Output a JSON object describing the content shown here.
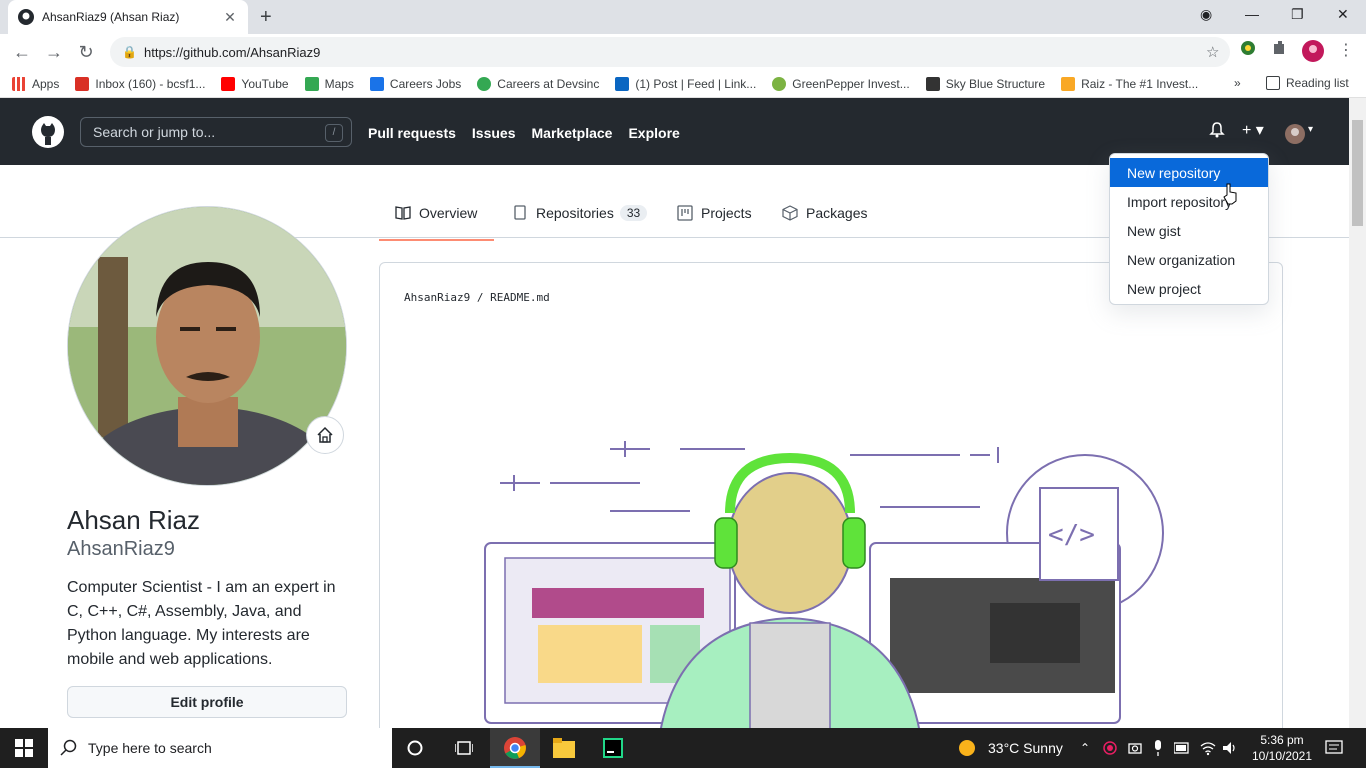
{
  "browser": {
    "tab_title": "AhsanRiaz9 (Ahsan Riaz)",
    "url": "https://github.com/AhsanRiaz9",
    "bookmarks": [
      {
        "label": "Apps",
        "color": "#ea4335"
      },
      {
        "label": "Inbox (160) - bcsf1...",
        "color": "#d93025"
      },
      {
        "label": "YouTube",
        "color": "#ff0000"
      },
      {
        "label": "Maps",
        "color": "#34a853"
      },
      {
        "label": "Careers Jobs",
        "color": "#1a73e8"
      },
      {
        "label": "Careers at Devsinc",
        "color": "#34a853"
      },
      {
        "label": "(1) Post | Feed | Link...",
        "color": "#0a66c2"
      },
      {
        "label": "GreenPepper Invest...",
        "color": "#7cb342"
      },
      {
        "label": "Sky Blue Structure",
        "color": "#333333"
      },
      {
        "label": "Raiz - The #1 Invest...",
        "color": "#f9a825"
      }
    ],
    "reading_list": "Reading list"
  },
  "github": {
    "search_placeholder": "Search or jump to...",
    "search_key": "/",
    "nav": [
      "Pull requests",
      "Issues",
      "Marketplace",
      "Explore"
    ],
    "tabs": {
      "overview": "Overview",
      "repositories": "Repositories",
      "repositories_count": "33",
      "projects": "Projects",
      "packages": "Packages"
    },
    "profile": {
      "name": "Ahsan Riaz",
      "login": "AhsanRiaz9",
      "bio": "Computer Scientist - I am an expert in C, C++, C#, Assembly, Java, and Python language. My interests are mobile and web applications.",
      "edit_button": "Edit profile"
    },
    "readme_path_user": "AhsanRiaz9",
    "readme_path_sep": " / ",
    "readme_path_file": "README.md",
    "dropdown": {
      "items": [
        "New repository",
        "Import repository",
        "New gist",
        "New organization",
        "New project"
      ]
    }
  },
  "taskbar": {
    "search_placeholder": "Type here to search",
    "weather": "33°C  Sunny",
    "time": "5:36 pm",
    "date": "10/10/2021"
  },
  "colors": {
    "gh_header": "#24292f",
    "accent_blue": "#0969da",
    "tab_underline": "#fd8c73"
  }
}
